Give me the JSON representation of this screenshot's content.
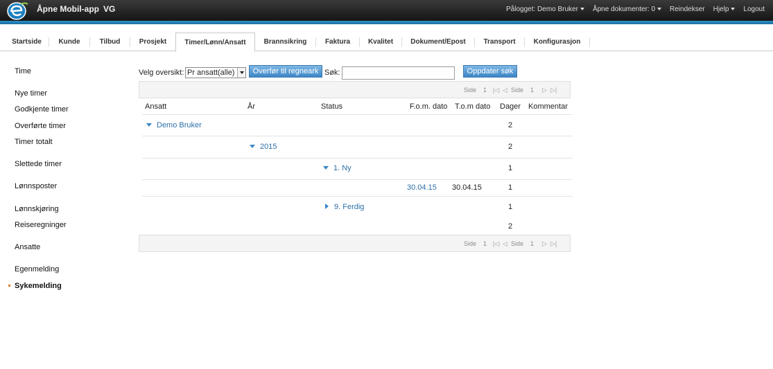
{
  "header": {
    "app_title": "Åpne Mobil-app",
    "app_sub": "VG",
    "logged_in": "Pålogget: Demo Bruker",
    "open_docs": "Åpne dokumenter: 0",
    "reindex": "Reindekser",
    "help": "Hjelp",
    "logout": "Logout"
  },
  "tabs": [
    "Startside",
    "Kunde",
    "Tilbud",
    "Prosjekt",
    "Timer/Lønn/Ansatt",
    "Brannsikring",
    "Faktura",
    "Kvalitet",
    "Dokument/Epost",
    "Transport",
    "Konfigurasjon"
  ],
  "active_tab": "Timer/Lønn/Ansatt",
  "sidebar": [
    "Time",
    "Nye timer",
    "Godkjente timer",
    "Overførte timer",
    "Timer totalt",
    "Slettede timer",
    "Lønnsposter",
    "Lønnskjøring",
    "Reiseregninger",
    "Ansatte",
    "Egenmelding",
    "Sykemelding"
  ],
  "sidebar_active": "Sykemelding",
  "controls": {
    "overview_label": "Velg oversikt:",
    "overview_value": "Pr ansatt(alle)",
    "transfer_button": "Overfør til regneark",
    "search_label": "Søk:",
    "search_value": "",
    "update_button": "Oppdater søk"
  },
  "pager": {
    "page_label": "Side",
    "page_value": "1"
  },
  "columns": [
    "Ansatt",
    "År",
    "Status",
    "F.o.m. dato",
    "T.o.m dato",
    "Dager",
    "Kommentar"
  ],
  "rows": {
    "employee": {
      "name": "Demo Bruker",
      "days": "2"
    },
    "year": {
      "label": "2015",
      "days": "2"
    },
    "status_new": {
      "label": "1. Ny",
      "days": "1"
    },
    "entry": {
      "from": "30.04.15",
      "to": "30.04.15",
      "days": "1"
    },
    "status_done": {
      "label": "9. Ferdig",
      "days": "1"
    },
    "total_days": "2"
  },
  "colors": {
    "accent": "#2f8fc5",
    "link": "#2b6fa8",
    "bullet": "#e07b1a"
  }
}
